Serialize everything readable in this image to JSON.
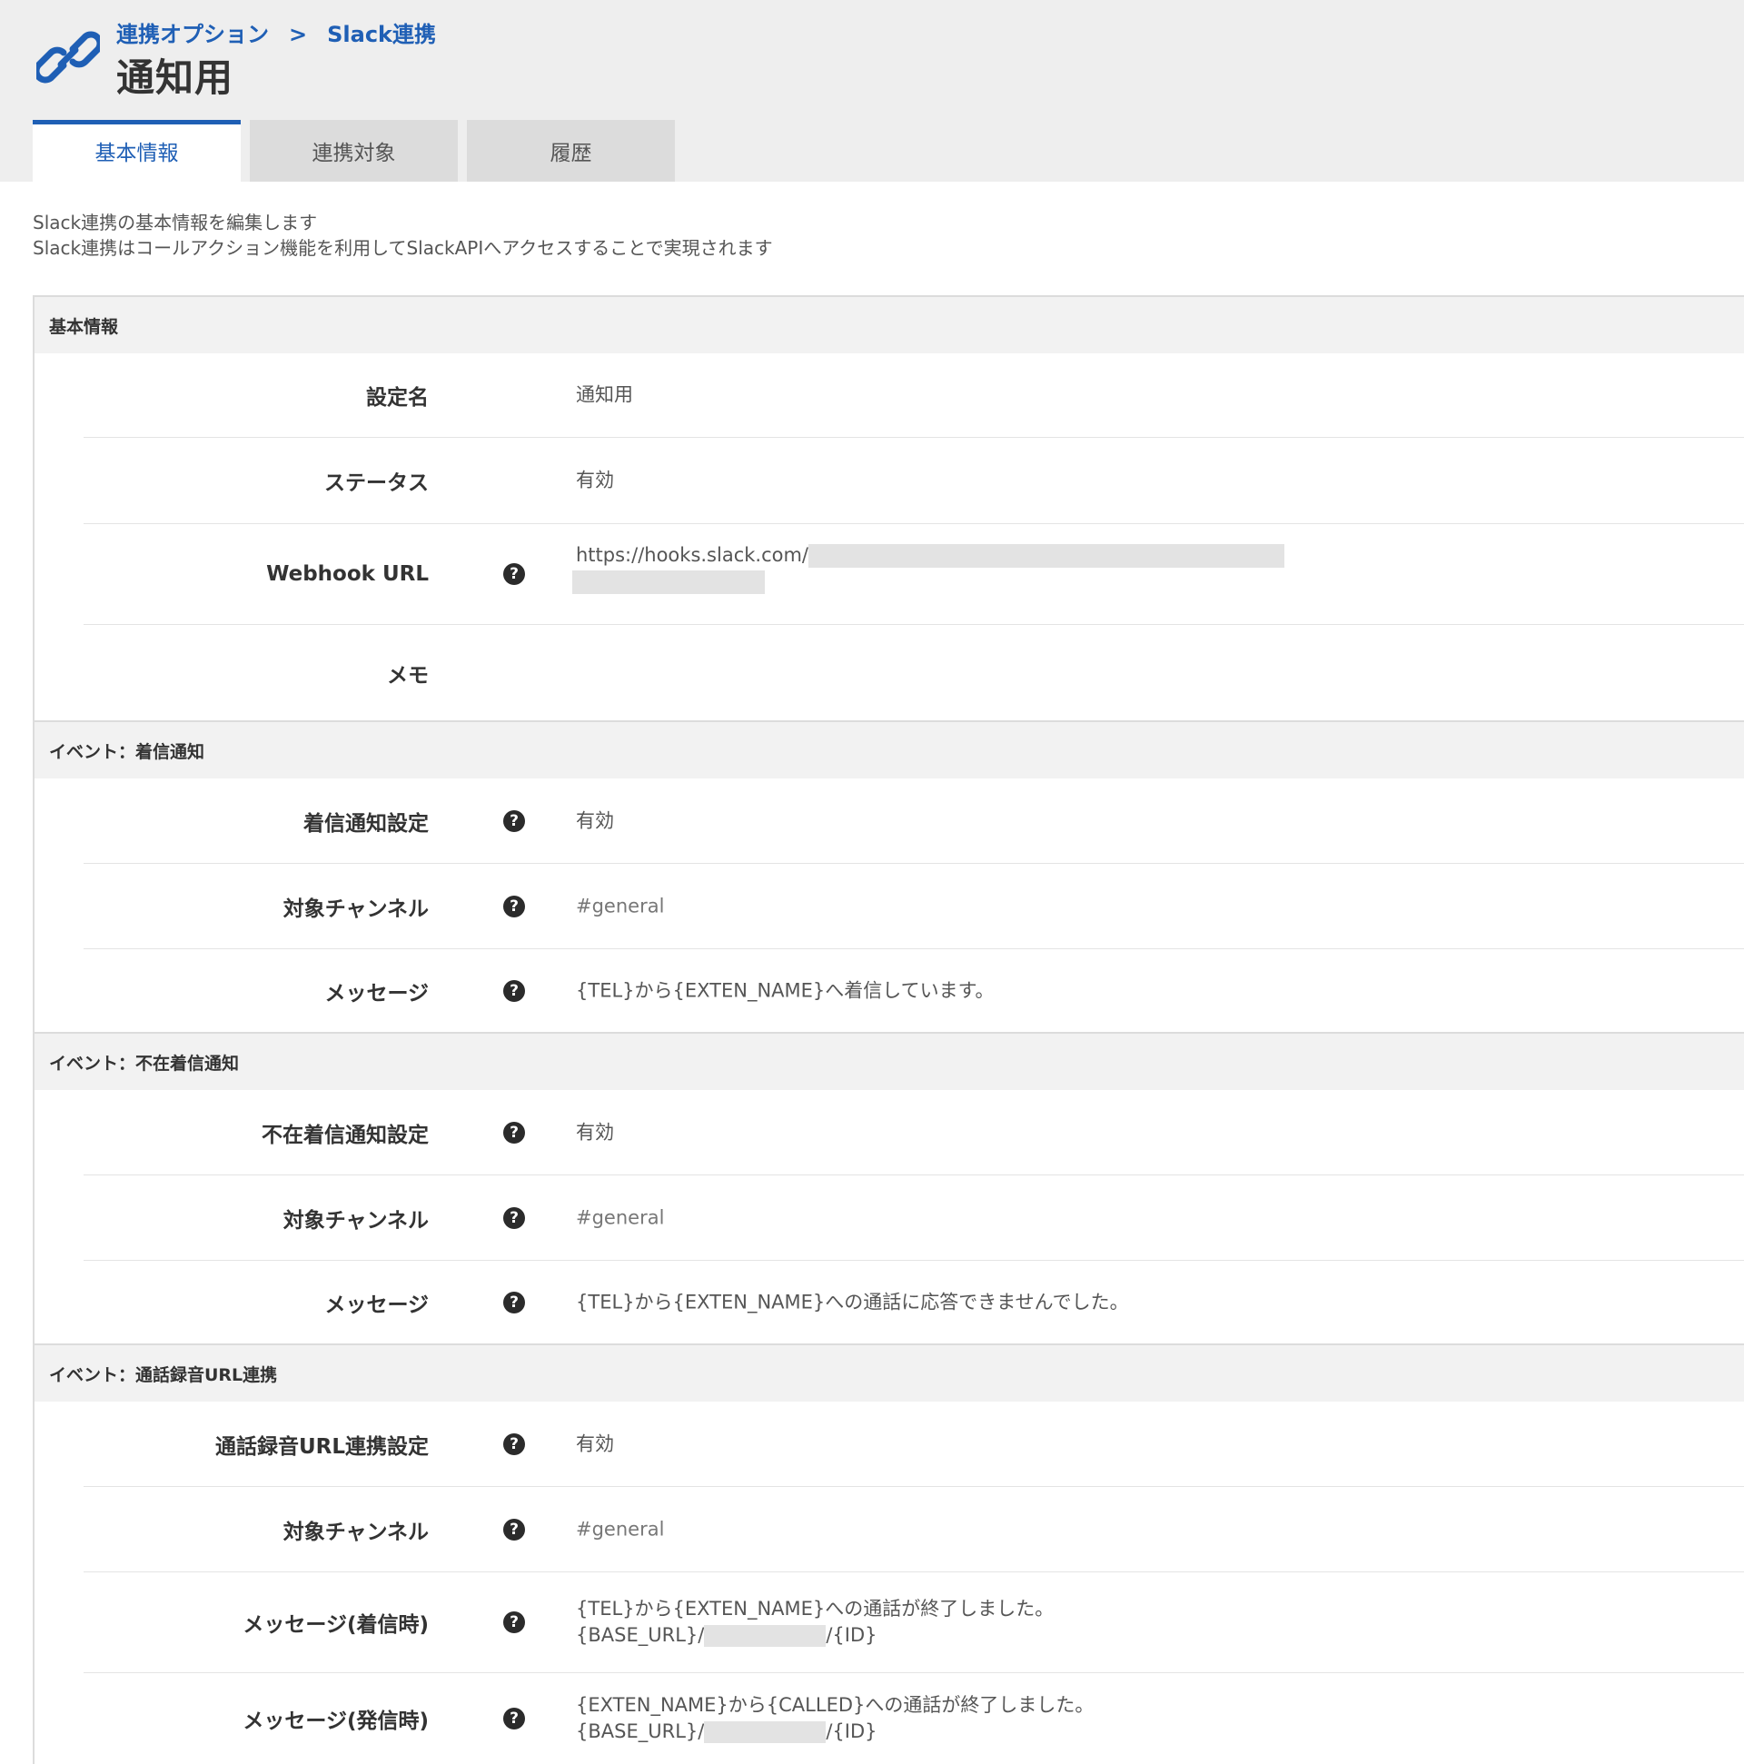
{
  "breadcrumb": {
    "parent": "連携オプション",
    "separator": ">",
    "current": "Slack連携"
  },
  "page_title": "通知用",
  "tabs": [
    {
      "label": "基本情報",
      "active": true
    },
    {
      "label": "連携対象",
      "active": false
    },
    {
      "label": "履歴",
      "active": false
    }
  ],
  "intro": {
    "line1": "Slack連携の基本情報を編集します",
    "line2": "Slack連携はコールアクション機能を利用してSlackAPIへアクセスすることで実現されます"
  },
  "sections": {
    "basic": {
      "title": "基本情報",
      "setting_name_label": "設定名",
      "setting_name_value": "通知用",
      "status_label": "ステータス",
      "status_value": "有効",
      "webhook_label": "Webhook URL",
      "webhook_value": "https://hooks.slack.com/",
      "memo_label": "メモ",
      "memo_value": ""
    },
    "incoming": {
      "title": "イベント：着信通知",
      "setting_label": "着信通知設定",
      "setting_value": "有効",
      "channel_label": "対象チャンネル",
      "channel_value": "#general",
      "message_label": "メッセージ",
      "message_value": "{TEL}から{EXTEN_NAME}へ着信しています。"
    },
    "missed": {
      "title": "イベント：不在着信通知",
      "setting_label": "不在着信通知設定",
      "setting_value": "有効",
      "channel_label": "対象チャンネル",
      "channel_value": "#general",
      "message_label": "メッセージ",
      "message_value": "{TEL}から{EXTEN_NAME}への通話に応答できませんでした。"
    },
    "recording": {
      "title": "イベント：通話録音URL連携",
      "setting_label": "通話録音URL連携設定",
      "setting_value": "有効",
      "channel_label": "対象チャンネル",
      "channel_value": "#general",
      "msg_in_label": "メッセージ(着信時)",
      "msg_in_line1": "{TEL}から{EXTEN_NAME}への通話が終了しました。",
      "msg_in_line2_prefix": "{BASE_URL}/",
      "msg_in_line2_suffix": "/{ID}",
      "msg_out_label": "メッセージ(発信時)",
      "msg_out_line1": "{EXTEN_NAME}から{CALLED}への通話が終了しました。",
      "msg_out_line2_prefix": "{BASE_URL}/",
      "msg_out_line2_suffix": "/{ID}"
    }
  },
  "help_glyph": "?",
  "colors": {
    "accent": "#1f5fb5",
    "header_bg": "#eeeeee",
    "section_bg": "#f2f2f2"
  },
  "icons": [
    "link-icon",
    "help-icon"
  ]
}
